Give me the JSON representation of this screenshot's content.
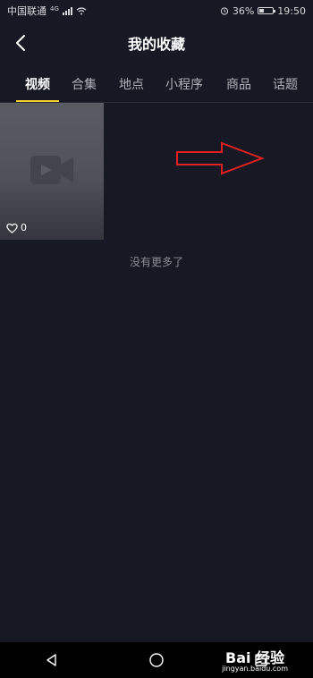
{
  "status_bar": {
    "carrier": "中国联通",
    "network": "4G",
    "battery": "36%",
    "battery_level": 0.36,
    "time": "19:50"
  },
  "header": {
    "title": "我的收藏"
  },
  "tabs": [
    {
      "label": "视频",
      "active": true
    },
    {
      "label": "合集",
      "active": false
    },
    {
      "label": "地点",
      "active": false
    },
    {
      "label": "小程序",
      "active": false
    },
    {
      "label": "商品",
      "active": false
    },
    {
      "label": "话题",
      "active": false
    }
  ],
  "video_card": {
    "like_count": "0"
  },
  "footer": {
    "no_more_text": "没有更多了"
  },
  "watermark": {
    "brand": "Bai 经验",
    "url": "jingyan.baidu.com"
  },
  "colors": {
    "background": "#161823",
    "tab_underline": "#fbd22d",
    "annotation_arrow": "#e02020"
  },
  "icons": [
    "back-arrow-icon",
    "video-camera-icon",
    "heart-icon",
    "back-triangle-icon",
    "home-circle-icon",
    "recent-square-icon"
  ]
}
